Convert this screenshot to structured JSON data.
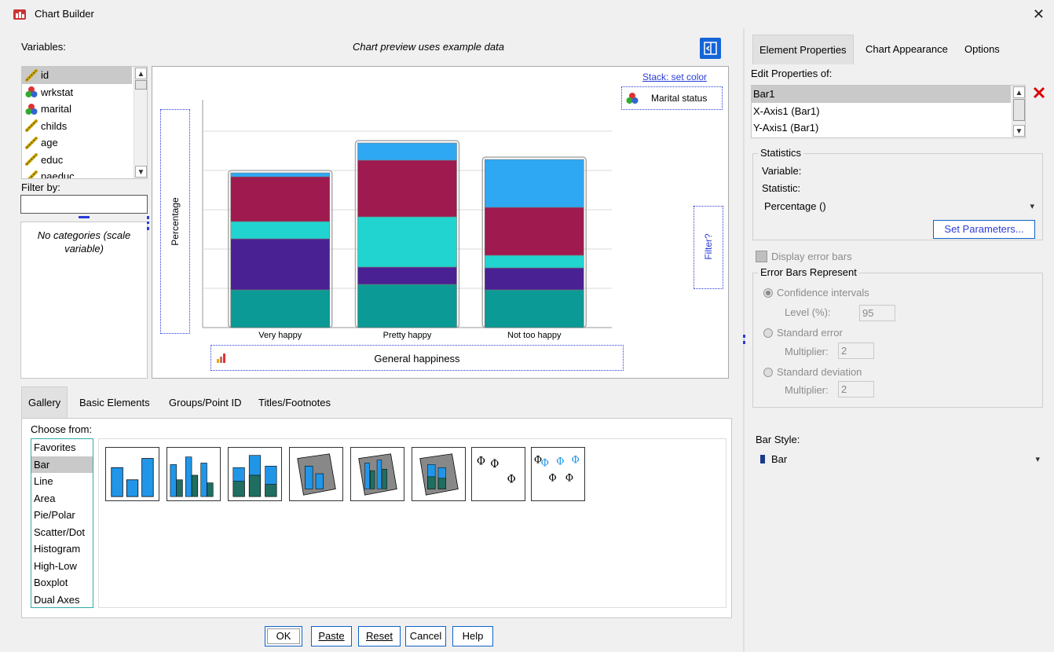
{
  "window": {
    "title": "Chart Builder",
    "close_symbol": "✕"
  },
  "variables": {
    "label": "Variables:",
    "items": [
      {
        "name": "id",
        "icon": "scale-ruler-icon"
      },
      {
        "name": "wrkstat",
        "icon": "nominal-icon"
      },
      {
        "name": "marital",
        "icon": "nominal-icon"
      },
      {
        "name": "childs",
        "icon": "scale-ruler-icon"
      },
      {
        "name": "age",
        "icon": "scale-ruler-icon"
      },
      {
        "name": "educ",
        "icon": "scale-ruler-icon"
      },
      {
        "name": "paeduc",
        "icon": "scale-ruler-icon"
      }
    ]
  },
  "filter": {
    "label": "Filter by:",
    "value": ""
  },
  "categories": {
    "text": "No categories (scale variable)"
  },
  "preview": {
    "caption": "Chart preview uses example data",
    "stack_label": "Stack: set color",
    "legend_var": "Marital status",
    "y_axis_label": "Percentage",
    "x_axis_label": "General happiness",
    "filter_label": "Filter?"
  },
  "chart_data": {
    "type": "bar",
    "stacked": true,
    "categories": [
      "Very happy",
      "Pretty happy",
      "Not too happy"
    ],
    "series": [
      {
        "color": "#0b9a95",
        "values": [
          48,
          55,
          48
        ]
      },
      {
        "color": "#4a2193",
        "values": [
          65,
          22,
          28
        ]
      },
      {
        "color": "#21d4cf",
        "values": [
          22,
          64,
          16
        ]
      },
      {
        "color": "#9e1a4f",
        "values": [
          57,
          72,
          61
        ]
      },
      {
        "color": "#2fa8f4",
        "values": [
          5,
          22,
          61
        ]
      }
    ],
    "ylim": [
      0,
      290
    ],
    "grid": true
  },
  "tabs": [
    "Gallery",
    "Basic Elements",
    "Groups/Point ID",
    "Titles/Footnotes"
  ],
  "gallery": {
    "choose_label": "Choose from:",
    "items": [
      "Favorites",
      "Bar",
      "Line",
      "Area",
      "Pie/Polar",
      "Scatter/Dot",
      "Histogram",
      "High-Low",
      "Boxplot",
      "Dual Axes"
    ],
    "selected": "Bar",
    "thumbs": [
      "simple-bar-icon",
      "clustered-bar-icon",
      "stacked-bar-icon",
      "3d-simple-bar-icon",
      "3d-clustered-bar-icon",
      "3d-stacked-bar-icon",
      "simple-error-bar-icon",
      "clustered-error-bar-icon"
    ]
  },
  "buttons": {
    "ok": "OK",
    "paste": "Paste",
    "reset": "Reset",
    "cancel": "Cancel",
    "help": "Help"
  },
  "right": {
    "tabs": [
      "Element Properties",
      "Chart Appearance",
      "Options"
    ],
    "edit_label": "Edit Properties of:",
    "props": [
      "Bar1",
      "X-Axis1 (Bar1)",
      "Y-Axis1 (Bar1)"
    ],
    "statistics": {
      "title": "Statistics",
      "variable_label": "Variable:",
      "statistic_label": "Statistic:",
      "statistic_value": "Percentage ()",
      "set_params": "Set Parameters..."
    },
    "error_bars": {
      "display_label": "Display error bars",
      "represent_title": "Error Bars Represent",
      "ci_label": "Confidence intervals",
      "level_label": "Level (%):",
      "level_value": "95",
      "se_label": "Standard error",
      "se_mult_label": "Multiplier:",
      "se_mult_value": "2",
      "sd_label": "Standard deviation",
      "sd_mult_label": "Multiplier:",
      "sd_mult_value": "2"
    },
    "bar_style": {
      "label": "Bar Style:",
      "value": "Bar"
    }
  }
}
